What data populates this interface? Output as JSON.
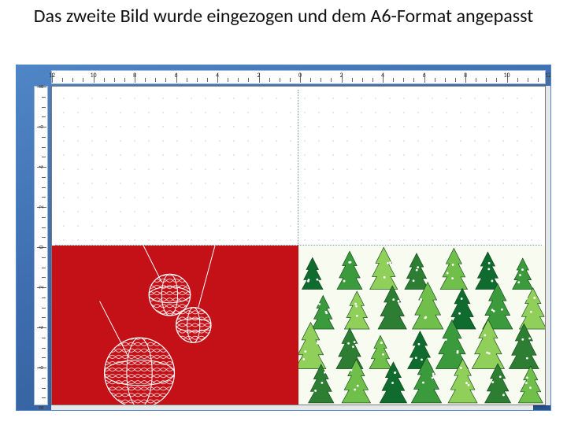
{
  "title": "Das zweite Bild wurde eingezogen und dem A6-Format angepasst",
  "ruler": {
    "h_labels": [
      "12",
      "10",
      "8",
      "6",
      "4",
      "2",
      "0",
      "2",
      "4",
      "6",
      "8",
      "10",
      "12"
    ],
    "v_labels": [
      "8",
      "6",
      "4",
      "2",
      "0",
      "2",
      "4",
      "6",
      "8"
    ]
  },
  "quadrants": {
    "top_left": "blank",
    "top_right": "blank",
    "bottom_left": "red-ornaments-image",
    "bottom_right": "green-trees-image"
  },
  "colors": {
    "background_gradient_from": "#4f86c6",
    "background_gradient_to": "#2c5590",
    "red_panel": "#c41017",
    "tree_dark": "#0f6b2e",
    "tree_mid": "#3b9a3b",
    "tree_light": "#8fcf5a",
    "ornament_line": "#ffffff"
  }
}
